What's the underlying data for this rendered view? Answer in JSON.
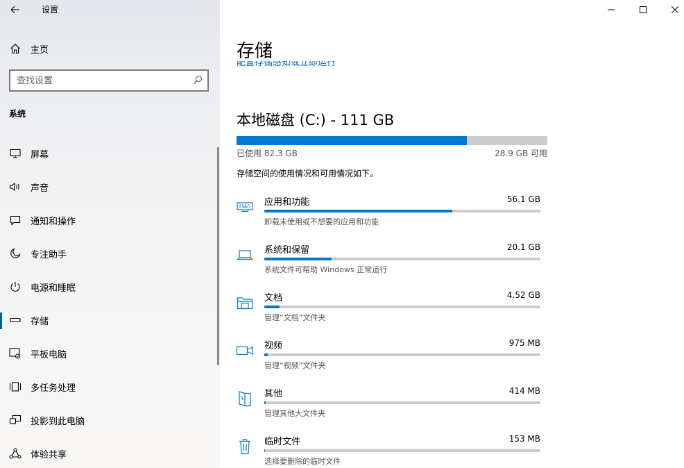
{
  "app": {
    "title": "设置"
  },
  "sidebar": {
    "home_label": "主页",
    "search_placeholder": "查找设置",
    "section": "系统",
    "items": [
      {
        "id": "display",
        "label": "屏幕",
        "icon": "monitor-icon"
      },
      {
        "id": "sound",
        "label": "声音",
        "icon": "speaker-icon"
      },
      {
        "id": "notifications",
        "label": "通知和操作",
        "icon": "message-icon"
      },
      {
        "id": "focus",
        "label": "专注助手",
        "icon": "moon-icon"
      },
      {
        "id": "power",
        "label": "电源和睡眠",
        "icon": "power-icon"
      },
      {
        "id": "storage",
        "label": "存储",
        "icon": "storage-icon",
        "selected": true
      },
      {
        "id": "tablet",
        "label": "平板电脑",
        "icon": "tablet-icon"
      },
      {
        "id": "multitasking",
        "label": "多任务处理",
        "icon": "multitask-icon"
      },
      {
        "id": "projecting",
        "label": "投影到此电脑",
        "icon": "project-icon"
      },
      {
        "id": "shared",
        "label": "体验共享",
        "icon": "share-icon"
      }
    ]
  },
  "main": {
    "title": "存储",
    "cut_link": "配置存储感知或立即运行",
    "disk": {
      "title": "本地磁盘 (C:) - 111 GB",
      "used_label": "已使用 82.3 GB",
      "free_label": "28.9 GB 可用",
      "used_fraction": 0.7414
    },
    "description": "存储空间的使用情况和可用情况如下。",
    "categories": [
      {
        "name": "应用和功能",
        "size": "56.1 GB",
        "sub": "卸载未使用或不想要的应用和功能",
        "fraction": 0.682,
        "icon": "keyboard-icon"
      },
      {
        "name": "系统和保留",
        "size": "20.1 GB",
        "sub": "系统文件可帮助 Windows 正常运行",
        "fraction": 0.244,
        "icon": "laptop-icon"
      },
      {
        "name": "文档",
        "size": "4.52 GB",
        "sub": "管理“文档”文件夹",
        "fraction": 0.055,
        "icon": "folder-icon"
      },
      {
        "name": "视频",
        "size": "975 MB",
        "sub": "管理“视频”文件夹",
        "fraction": 0.012,
        "icon": "video-icon"
      },
      {
        "name": "其他",
        "size": "414 MB",
        "sub": "管理其他大文件夹",
        "fraction": 0.005,
        "icon": "file-icon"
      },
      {
        "name": "临时文件",
        "size": "153 MB",
        "sub": "选择要删除的临时文件",
        "fraction": 0.002,
        "icon": "trash-icon"
      }
    ]
  },
  "colors": {
    "accent": "#0078d4",
    "bar_track": "#cccccc",
    "link": "#0067c0"
  }
}
